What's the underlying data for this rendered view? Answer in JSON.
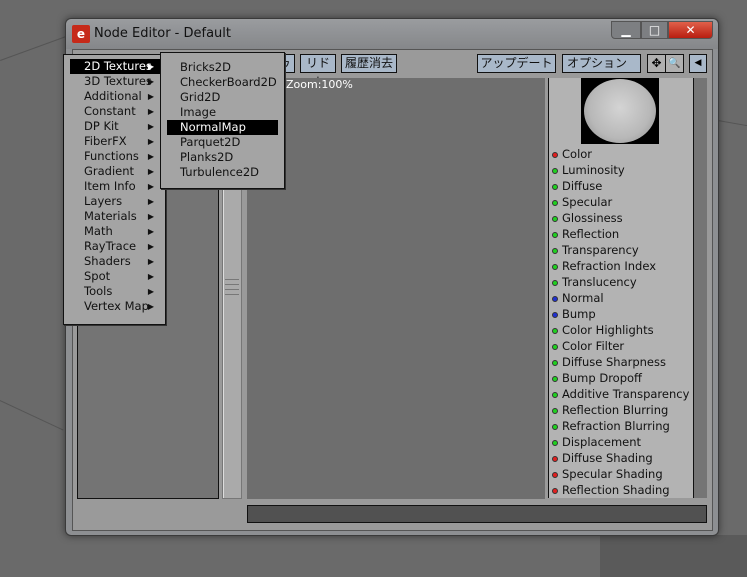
{
  "window": {
    "title": "Node Editor - Default",
    "minimize": "▁",
    "maximize": "□",
    "close": "✕"
  },
  "toolbar": {
    "undo_partial": "ゥ",
    "redo": "リドゥ",
    "clear_history": "履歴消去",
    "update": "アップデート",
    "options": "オプション",
    "move_icon": "✥",
    "zoom_icon": "🔍",
    "collapse_icon": "◀"
  },
  "canvas": {
    "zoom_label": "Zoom:100%"
  },
  "main_menu": [
    "2D Textures",
    "3D Textures",
    "Additional",
    "Constant",
    "DP Kit",
    "FiberFX",
    "Functions",
    "Gradient",
    "Item Info",
    "Layers",
    "Materials",
    "Math",
    "RayTrace",
    "Shaders",
    "Spot",
    "Tools",
    "Vertex Map"
  ],
  "submenu": [
    "Bricks2D",
    "CheckerBoard2D",
    "Grid2D",
    "Image",
    "NormalMap",
    "Parquet2D",
    "Planks2D",
    "Turbulence2D"
  ],
  "selected_main": "2D Textures",
  "selected_sub": "NormalMap",
  "inputs": [
    {
      "label": "Color",
      "color": "#e02020"
    },
    {
      "label": "Luminosity",
      "color": "#20d020"
    },
    {
      "label": "Diffuse",
      "color": "#20d020"
    },
    {
      "label": "Specular",
      "color": "#20d020"
    },
    {
      "label": "Glossiness",
      "color": "#20d020"
    },
    {
      "label": "Reflection",
      "color": "#20d020"
    },
    {
      "label": "Transparency",
      "color": "#20d020"
    },
    {
      "label": "Refraction Index",
      "color": "#20d020"
    },
    {
      "label": "Translucency",
      "color": "#20d020"
    },
    {
      "label": "Normal",
      "color": "#2030d0"
    },
    {
      "label": "Bump",
      "color": "#2030d0"
    },
    {
      "label": "Color Highlights",
      "color": "#20d020"
    },
    {
      "label": "Color Filter",
      "color": "#20d020"
    },
    {
      "label": "Diffuse Sharpness",
      "color": "#20d020"
    },
    {
      "label": "Bump Dropoff",
      "color": "#20d020"
    },
    {
      "label": "Additive Transparency",
      "color": "#20d020"
    },
    {
      "label": "Reflection Blurring",
      "color": "#20d020"
    },
    {
      "label": "Refraction Blurring",
      "color": "#20d020"
    },
    {
      "label": "Displacement",
      "color": "#20d020"
    },
    {
      "label": "Diffuse Shading",
      "color": "#e02020"
    },
    {
      "label": "Specular Shading",
      "color": "#e02020"
    },
    {
      "label": "Reflection Shading",
      "color": "#e02020"
    }
  ]
}
